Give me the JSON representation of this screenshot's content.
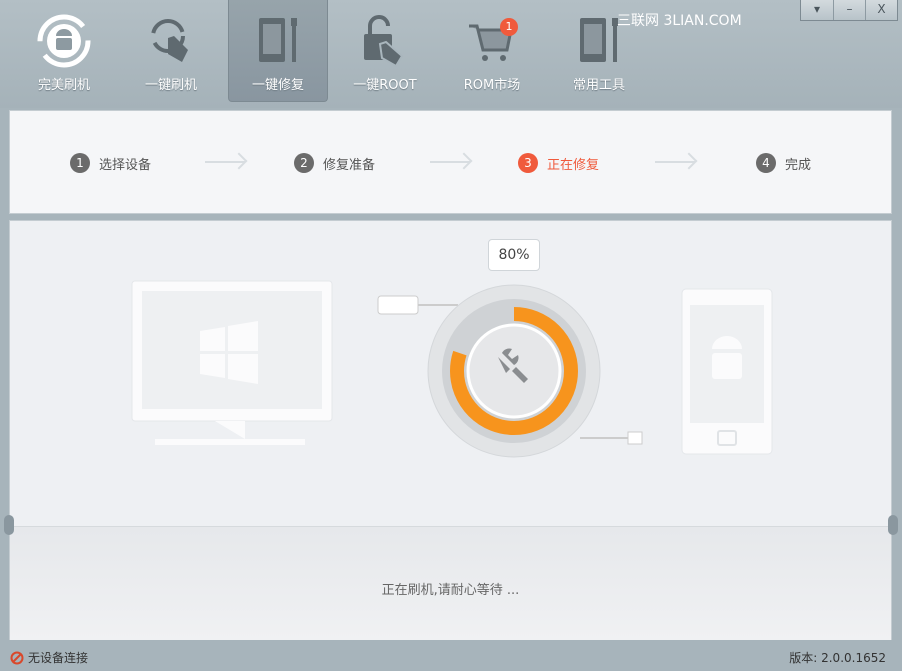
{
  "nav": [
    {
      "label": "完美刷机",
      "icon": "android-refresh-icon"
    },
    {
      "label": "一键刷机",
      "icon": "tap-refresh-icon"
    },
    {
      "label": "一键修复",
      "icon": "phone-wrench-icon",
      "active": true
    },
    {
      "label": "一键ROOT",
      "icon": "unlock-icon"
    },
    {
      "label": "ROM市场",
      "icon": "cart-icon",
      "badge": "1"
    },
    {
      "label": "常用工具",
      "icon": "tools-icon"
    }
  ],
  "watermark": "三联网 3LIAN.COM",
  "window_buttons": {
    "menu": "▾",
    "minimize": "–",
    "close": "X"
  },
  "steps": [
    {
      "num": "1",
      "label": "选择设备"
    },
    {
      "num": "2",
      "label": "修复准备"
    },
    {
      "num": "3",
      "label": "正在修复",
      "current": true
    },
    {
      "num": "4",
      "label": "完成"
    }
  ],
  "progress": {
    "label": "80%",
    "value": 80
  },
  "message": "正在刷机,请耐心等待 ...",
  "status": {
    "connection": "无设备连接",
    "version": "版本: 2.0.0.1652"
  },
  "colors": {
    "accent": "#f05a3c",
    "orange": "#f7941d"
  }
}
